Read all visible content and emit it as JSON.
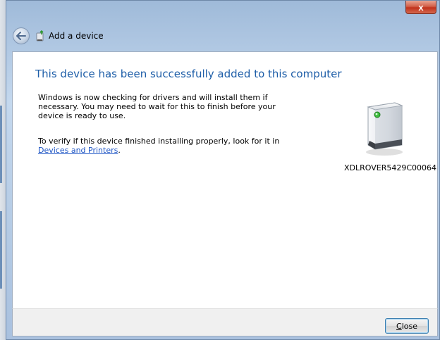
{
  "window": {
    "title": "Add a device",
    "close_glyph": "x",
    "back_icon": "back-arrow-icon"
  },
  "content": {
    "heading": "This device has been successfully added to this computer",
    "para1": "Windows is now checking for drivers and will install them if necessary. You may need to wait for this to finish before your device is ready to use.",
    "para2_text": "To verify if this device finished installing properly, look for it in ",
    "para2_link": "Devices and Printers",
    "para2_end": ".",
    "device_name": "XDLROVER5429C00064",
    "device_icon": "printer-device-icon"
  },
  "footer": {
    "close_accel": "C",
    "close_rest": "lose"
  },
  "colors": {
    "heading": "#1e5ea8",
    "link": "#1a52c4",
    "close_button": "#c1311b"
  }
}
